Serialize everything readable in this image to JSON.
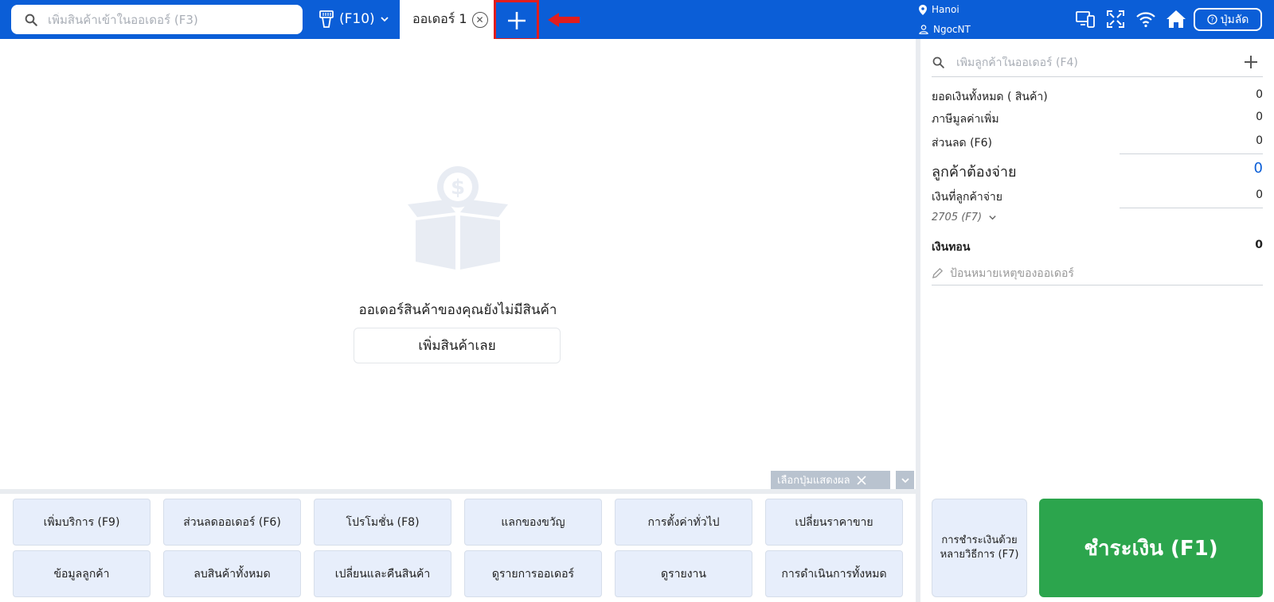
{
  "topbar": {
    "product_search_placeholder": "เพิ่มสินค้าเข้าในออเดอร์ (F3)",
    "scanner_label": "(F10)",
    "order_tab_label": "ออเดอร์ 1",
    "location": "Hanoi",
    "user": "NgocNT",
    "shortcut_label": "ปุ่มลัด",
    "icons": [
      "devices-icon",
      "fullscreen-icon",
      "wifi-icon",
      "home-icon"
    ]
  },
  "main": {
    "empty_message": "ออเดอร์สินค้าของคุณยังไม่มีสินค้า",
    "add_product_now": "เพิ่มสินค้าเลย",
    "pick_display_label": "เลือกปุ่มแสดงผล"
  },
  "function_buttons": [
    "เพิ่มบริการ (F9)",
    "ส่วนลดออเดอร์ (F6)",
    "โปรโมชั่น (F8)",
    "แลกของขวัญ",
    "การตั้งค่าทั่วไป",
    "เปลี่ยนราคาขาย",
    "ข้อมูลลูกค้า",
    "ลบสินค้าทั้งหมด",
    "เปลี่ยนและคืนสินค้า",
    "ดูรายการออเดอร์",
    "ดูรายงาน",
    "การดำเนินการทั้งหมด"
  ],
  "right_panel": {
    "customer_search_placeholder": "เพิ่มลูกค้าในออเดอร์ (F4)",
    "total_goods_label": "ยอดเงินทั้งหมด ( สินค้า)",
    "total_goods_value": "0",
    "vat_label": "ภาษีมูลค่าเพิ่ม",
    "vat_value": "0",
    "discount_label": "ส่วนลด (F6)",
    "discount_value": "0",
    "customer_pay_label": "ลูกค้าต้องจ่าย",
    "customer_pay_value": "0",
    "customer_paid_label": "เงินที่ลูกค้าจ่าย",
    "customer_paid_value": "0",
    "cash_selector": "2705 (F7)",
    "change_label": "เงินทอน",
    "change_value": "0",
    "note_placeholder": "ป้อนหมายเหตุของออเดอร์",
    "multi_pay_label": "การชำระเงินด้วยหลายวิธีการ (F7)",
    "pay_label": "ชำระเงิน (F1)"
  },
  "colors": {
    "brand": "#0b5ed7",
    "pay": "#2ca54d",
    "highlight": "#e11d1d"
  }
}
